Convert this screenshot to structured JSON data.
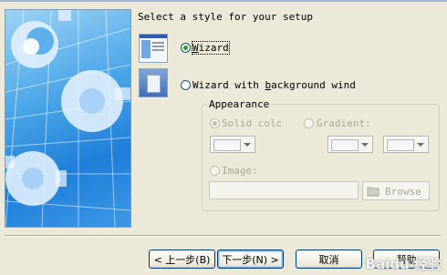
{
  "header": {
    "heading": "Select a style for your setup"
  },
  "styles": [
    {
      "label_pre": "",
      "label_key": "W",
      "label_post": "izard",
      "checked": true
    },
    {
      "label_pre": "Wizard with ",
      "label_key": "b",
      "label_post": "ackground wind",
      "checked": false
    }
  ],
  "appearance": {
    "legend": "Appearance",
    "solid_label": "Solid colc",
    "gradient_label": "Gradient:",
    "image_label": "Image:",
    "image_path": "",
    "browse_label": "Browse"
  },
  "buttons": {
    "back": "< 上一步(B)",
    "next": "下一步(N) >",
    "cancel": "取消",
    "help": "帮助"
  },
  "watermark": "Baidu 经验",
  "colors": {
    "selected_radio": "#21a121",
    "button_border": "#003c74",
    "dialog_bg": "#ece9d8"
  }
}
